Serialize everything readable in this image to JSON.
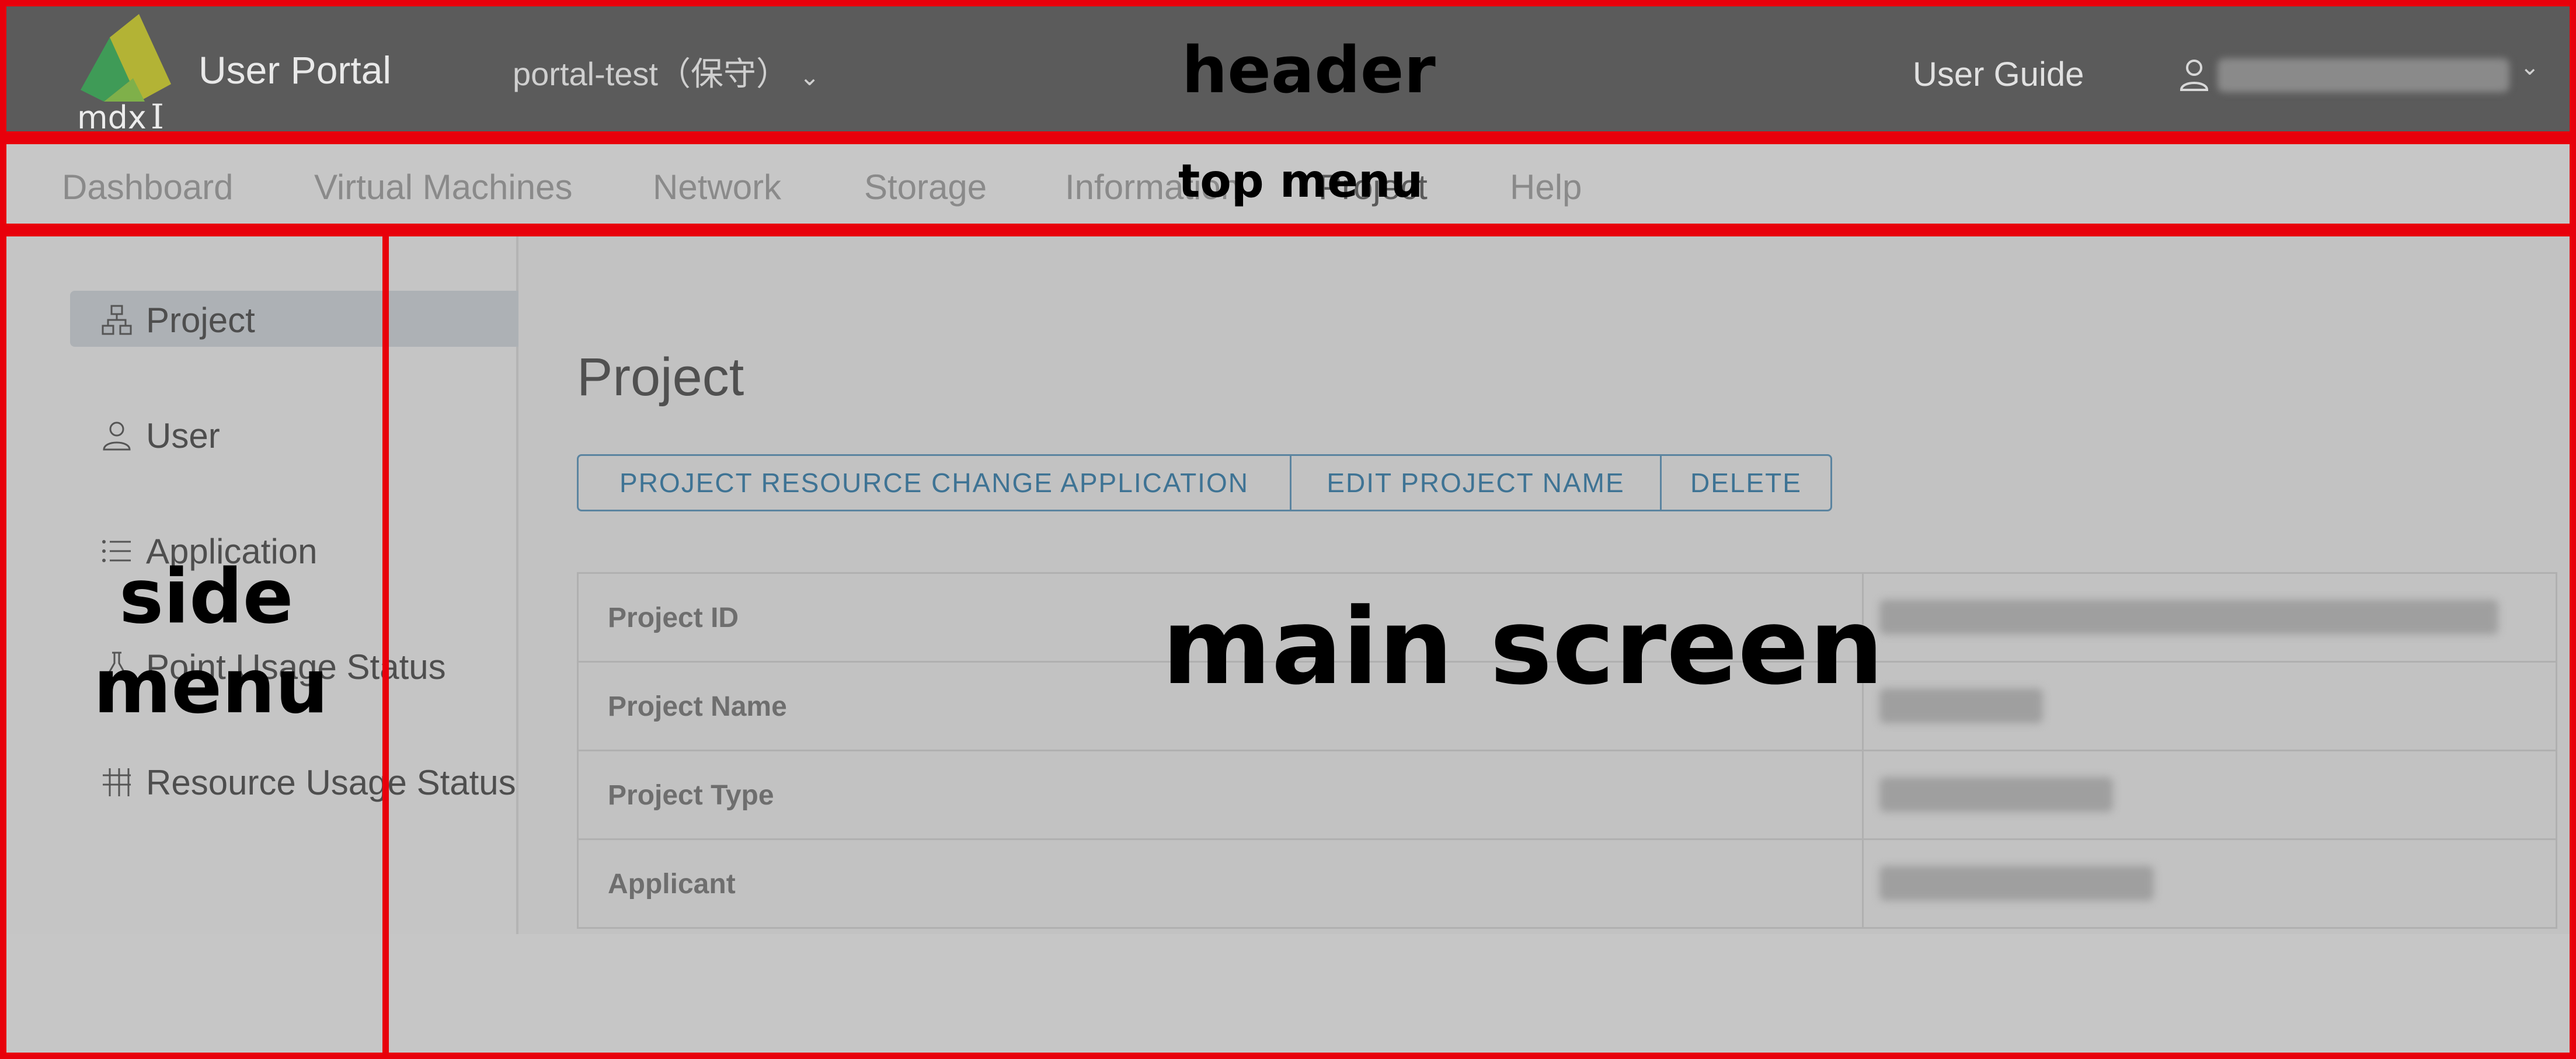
{
  "header": {
    "app_title": "User Portal",
    "project_selector": "portal-test（保守）",
    "user_guide": "User Guide"
  },
  "top_menu": {
    "items": [
      "Dashboard",
      "Virtual Machines",
      "Network",
      "Storage",
      "Information",
      "Project",
      "Help"
    ]
  },
  "side_menu": {
    "items": [
      "Project",
      "User",
      "Application",
      "Point Usage Status",
      "Resource Usage Status"
    ],
    "active": "Project"
  },
  "main": {
    "title": "Project",
    "buttons": [
      "PROJECT RESOURCE CHANGE APPLICATION",
      "EDIT PROJECT NAME",
      "DELETE"
    ],
    "rows": [
      "Project ID",
      "Project Name",
      "Project Type",
      "Applicant"
    ]
  },
  "annotations": {
    "header": "header",
    "top_menu": "top menu",
    "side_menu_1": "side",
    "side_menu_2": "menu",
    "main": "main screen"
  },
  "colors": {
    "frame": "#e8000b",
    "header_bg": "#5b5b5b",
    "button_accent": "#3e7394"
  }
}
